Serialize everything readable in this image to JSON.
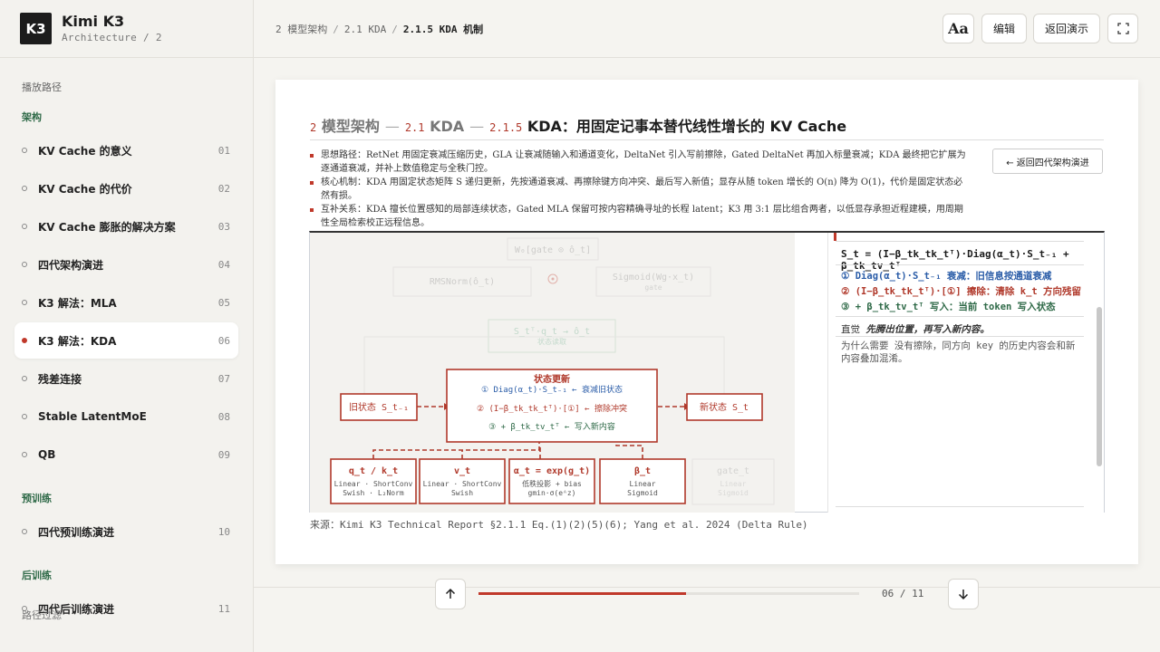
{
  "brand": {
    "logo": "K3",
    "title": "Kimi K3",
    "subtitle": "Architecture / 2"
  },
  "sidebar": {
    "route_label": "播放路径",
    "sections": {
      "arch": "架构",
      "pretrain": "预训练",
      "posttrain": "后训练"
    },
    "items": [
      {
        "label": "KV Cache 的意义",
        "num": "01"
      },
      {
        "label": "KV Cache 的代价",
        "num": "02"
      },
      {
        "label": "KV Cache 膨胀的解决方案",
        "num": "03"
      },
      {
        "label": "四代架构演进",
        "num": "04"
      },
      {
        "label": "K3 解法：MLA",
        "num": "05"
      },
      {
        "label": "K3 解法：KDA",
        "num": "06"
      },
      {
        "label": "残差连接",
        "num": "07"
      },
      {
        "label": "Stable LatentMoE",
        "num": "08"
      },
      {
        "label": "QB",
        "num": "09"
      },
      {
        "label": "四代预训练演进",
        "num": "10"
      },
      {
        "label": "四代后训练演进",
        "num": "11"
      }
    ],
    "overlay_label": "路径过滤"
  },
  "breadcrumb": {
    "c1": "2 模型架构",
    "c2": "2.1 KDA",
    "c3": "2.1.5 KDA 机制"
  },
  "toolbar": {
    "font": "Aa",
    "edit": "编辑",
    "back": "返回演示",
    "fullscreen_icon": "expand-icon"
  },
  "slide": {
    "title_num1": "2",
    "title_sec1": "模型架构",
    "title_num2": "2.1",
    "title_sec2": "KDA",
    "title_num3": "2.1.5",
    "title_main": "KDA：用固定记事本替代线性增长的 KV Cache",
    "bullets": [
      "思想路径：RetNet 用固定衰减压缩历史，GLA 让衰减随输入和通道变化，DeltaNet 引入写前擦除，Gated DeltaNet 再加入标量衰减；KDA 最终把它扩展为逐通道衰减，并补上数值稳定与全秩门控。",
      "核心机制：KDA 用固定状态矩阵 S 递归更新，先按通道衰减、再擦除键方向冲突、最后写入新值；显存从随 token 增长的 O(n) 降为 O(1)，代价是固定状态必然有损。",
      "互补关系：KDA 擅长位置感知的局部连续状态，Gated MLA 保留可按内容精确寻址的长程 latent；K3 用 3:1 层比组合两者，以低显存承担近程建模，用周期性全局检索校正远程信息。"
    ],
    "back_arch": "← 返回四代架构演进",
    "source": "来源：Kimi K3 Technical Report §2.1.1 Eq.(1)(2)(5)(6); Yang et al. 2024 (Delta Rule)"
  },
  "diagram": {
    "faded_top": "W₀[gate ⊙ ô_t]",
    "faded_norm": "RMSNorm(ô_t)",
    "faded_sig": "Sigmoid(Wg·x_t)",
    "faded_sig_sub": "gate",
    "faded_read": "S_tᵀ·q_t → ô_t",
    "faded_read_sub": "状态读取",
    "update_title": "状态更新",
    "update_l1": "① Diag(α_t)·S_t₋₁ ← 衰减旧状态",
    "update_l2": "② (I−β_tk_tk_tᵀ)·[①] ← 擦除冲突",
    "update_l3": "③ + β_tk_tv_tᵀ ← 写入新内容",
    "old_state": "旧状态 S_t₋₁",
    "new_state": "新状态 S_t",
    "inputs": [
      {
        "title": "q_t / k_t",
        "l1": "Linear · ShortConv",
        "l2": "Swish · L₂Norm"
      },
      {
        "title": "v_t",
        "l1": "Linear · ShortConv",
        "l2": "Swish"
      },
      {
        "title": "α_t = exp(g_t)",
        "l1": "低秩投影 + bias",
        "l2": "gmin·σ(eᴬz)"
      },
      {
        "title": "β_t",
        "l1": "Linear",
        "l2": "Sigmoid"
      },
      {
        "title": "gate_t",
        "l1": "Linear",
        "l2": "Sigmoid"
      }
    ]
  },
  "panel": {
    "eq": "S_t = (I−β_tk_tk_tᵀ)·Diag(α_t)·S_t₋₁ + β_tk_tv_tᵀ",
    "l1": "① Diag(α_t)·S_t₋₁ 衰减：旧信息按通道衰减",
    "l2": "② (I−β_tk_tk_tᵀ)·[①] 擦除：清除 k_t 方向残留",
    "l3": "③ + β_tk_tv_tᵀ 写入：当前 token 写入状态",
    "intuit_label": "直觉",
    "intuit_text": "先腾出位置，再写入新内容。",
    "why_label": "为什么需要",
    "why_text": "没有擦除，同方向 key 的历史内容会和新内容叠加混淆。"
  },
  "progress": {
    "label": "06 / 11",
    "value": 0.545
  },
  "colors": {
    "accent": "#c0392b",
    "blue": "#2b5da8",
    "green": "#2f6a48"
  }
}
